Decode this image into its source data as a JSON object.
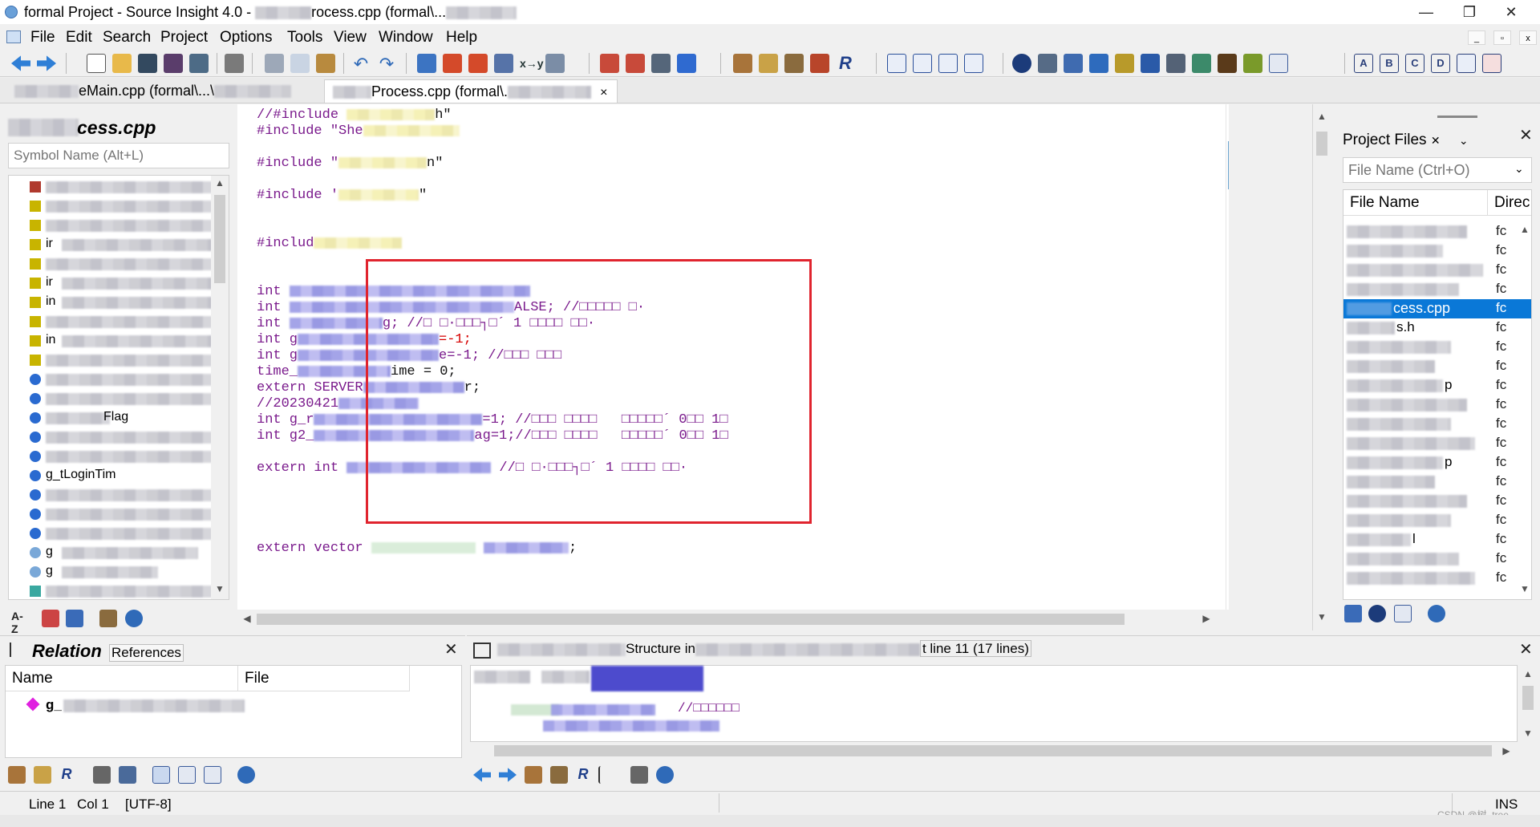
{
  "window": {
    "title": "formal Project - Source Insight 4.0 - ",
    "title_path": "rocess.cpp (formal\\..."
  },
  "menu": [
    "File",
    "Edit",
    "Search",
    "Project",
    "Options",
    "Tools",
    "View",
    "Window",
    "Help"
  ],
  "tabs": [
    {
      "label": "eMain.cpp (formal\\...\\"
    },
    {
      "label": "Process.cpp (formal\\.",
      "active": true,
      "close": "×"
    }
  ],
  "symbol_panel": {
    "title": "cess.cpp",
    "search_placeholder": "Symbol Name (Alt+L)",
    "visible_fragments": [
      "ir",
      "ir",
      "in",
      "ir",
      "in",
      "Flag",
      "g_tLoginTim",
      "g",
      "g"
    ]
  },
  "editor": {
    "lines": [
      {
        "text": "//#include ",
        "tail": "h\""
      },
      {
        "text": "#include \"She",
        "tail": ""
      },
      {
        "text": "#include \"",
        "tail": "n\""
      },
      {
        "text": "#include '",
        "tail": "\""
      },
      {
        "text": "#includ",
        "tail": ""
      },
      {
        "text": "int",
        "tail": ""
      },
      {
        "text": "int",
        "tail": "ALSE; //□□□□□ □·"
      },
      {
        "text": "int",
        "tail": "g; //□ □·□□□┐□´ 1 □□□□ □□·"
      },
      {
        "text": "int g",
        "tail": "=-1;"
      },
      {
        "text": "int g",
        "tail": "e=-1; //□□□ □□□"
      },
      {
        "text": "time_",
        "tail": "ime = 0;"
      },
      {
        "text": "extern SERVER",
        "tail": "r;"
      },
      {
        "text": "//20230421",
        "tail": ""
      },
      {
        "text": "int g_r",
        "tail": "=1; //□□□ □□□□   □□□□□´ 0□□ 1□"
      },
      {
        "text": "int g2_",
        "tail": "ag=1;//□□□ □□□□   □□□□□´ 0□□ 1□"
      },
      {
        "text": "extern int",
        "tail": " //□ □·□□□┐□´ 1 □□□□ □□·"
      },
      {
        "text": "extern vector",
        "tail": ";"
      }
    ]
  },
  "project_panel": {
    "tab_label": "Project Files",
    "search_placeholder": "File Name (Ctrl+O)",
    "col_name": "File Name",
    "col_dir": "Direc",
    "selected_file": "cess.cpp",
    "partial_names": [
      "s.h",
      "p",
      "p",
      "l"
    ],
    "dir_prefix": "fc"
  },
  "relation_panel": {
    "title": "Relation",
    "references": "References",
    "col_name": "Name",
    "col_file": "File",
    "row_prefix": "g_"
  },
  "context_panel": {
    "title_tail": "Structure in",
    "title_line": "t line 11 (17 lines)",
    "comment": "//□□□□□□"
  },
  "status": {
    "line": "Line 1",
    "col": "Col 1",
    "encoding": "[UTF-8]",
    "mode": "INS",
    "watermark": "CSDN @树_tree_"
  },
  "colors": {
    "keyword": "#7a1a8c",
    "number": "#d60000",
    "highlight_box": "#e0242e",
    "selection": "#0a78d7"
  }
}
